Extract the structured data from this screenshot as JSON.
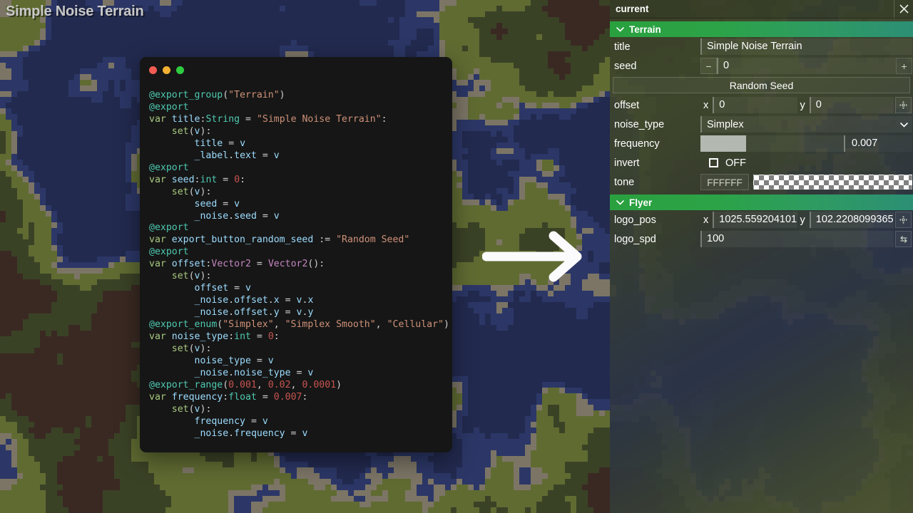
{
  "game": {
    "title_label": "Simple Noise Terrain",
    "arrow_icon": "arrow-right-icon",
    "terrain_palette": {
      "deep_water": "#222a4f",
      "shallow_water": "#2c3767",
      "sand": "#7c7566",
      "grass": "#606b32",
      "forest": "#3a4226",
      "rock": "#3a2922"
    }
  },
  "code_window": {
    "traffic_lights": [
      {
        "name": "close",
        "color": "#f25c54"
      },
      {
        "name": "minimize",
        "color": "#f2b134"
      },
      {
        "name": "zoom",
        "color": "#2ecc40"
      }
    ],
    "language": "GDScript",
    "lines": [
      "@export_group(\"Terrain\")",
      "@export",
      "var title:String = \"Simple Noise Terrain\":",
      "    set(v):",
      "        title = v",
      "        _label.text = v",
      "@export",
      "var seed:int = 0:",
      "    set(v):",
      "        seed = v",
      "        _noise.seed = v",
      "@export",
      "var export_button_random_seed := \"Random Seed\"",
      "@export",
      "var offset:Vector2 = Vector2():",
      "    set(v):",
      "        offset = v",
      "        _noise.offset.x = v.x",
      "        _noise.offset.y = v.y",
      "@export_enum(\"Simplex\", \"Simplex Smooth\", \"Cellular\")",
      "var noise_type:int = 0:",
      "    set(v):",
      "        noise_type = v",
      "        _noise.noise_type = v",
      "@export_range(0.001, 0.02, 0.0001)",
      "var frequency:float = 0.007:",
      "    set(v):",
      "        frequency = v",
      "        _noise.frequency = v"
    ]
  },
  "inspector": {
    "header": {
      "title": "current",
      "close_icon": "close-icon"
    },
    "groups": [
      {
        "name": "Terrain",
        "expanded": true,
        "chevron_icon": "chevron-down-icon",
        "rows": [
          {
            "kind": "text",
            "label": "title",
            "value": "Simple Noise Terrain"
          },
          {
            "kind": "stepper",
            "label": "seed",
            "value": "0",
            "minus_label": "−",
            "plus_label": "+"
          },
          {
            "kind": "button",
            "label": "",
            "button_label": "Random Seed"
          },
          {
            "kind": "vector2",
            "label": "offset",
            "x_label": "x",
            "x_value": "0",
            "y_label": "y",
            "y_value": "0",
            "side_icon": "link-axes-icon"
          },
          {
            "kind": "dropdown",
            "label": "noise_type",
            "value": "Simplex",
            "chevron_icon": "chevron-down-icon",
            "options": [
              "Simplex",
              "Simplex Smooth",
              "Cellular"
            ]
          },
          {
            "kind": "slider",
            "label": "frequency",
            "value": "0.007",
            "min": 0.001,
            "max": 0.02,
            "step": 0.0001,
            "fill_percent": 31.6
          },
          {
            "kind": "checkbox",
            "label": "invert",
            "state_label": "OFF",
            "checked": false
          },
          {
            "kind": "color",
            "label": "tone",
            "hex": "FFFFFF",
            "alpha": 0
          }
        ]
      },
      {
        "name": "Flyer",
        "expanded": true,
        "chevron_icon": "chevron-down-icon",
        "rows": [
          {
            "kind": "vector2",
            "label": "logo_pos",
            "x_label": "x",
            "x_value": "1025.559204101",
            "y_label": "y",
            "y_value": "102.2208099365",
            "side_icon": "link-axes-icon"
          },
          {
            "kind": "text-revert",
            "label": "logo_spd",
            "value": "100",
            "side_icon": "revert-icon"
          }
        ]
      }
    ]
  },
  "colors": {
    "group_header_green": "#2aa13f",
    "group_header_teal": "#2c8f74",
    "panel_text": "#ffffff"
  }
}
